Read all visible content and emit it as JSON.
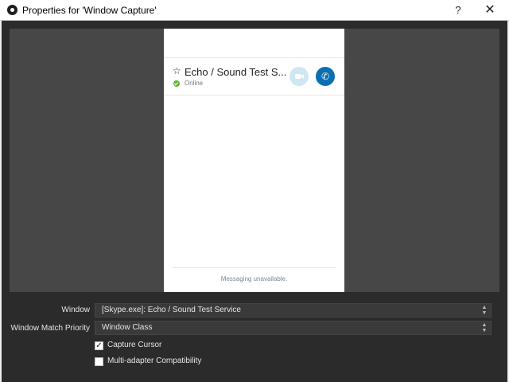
{
  "window": {
    "title": "Properties for 'Window Capture'",
    "help_label": "?",
    "close_label": "✕"
  },
  "capture": {
    "contact_name": "Echo / Sound Test S...",
    "contact_status": "Online",
    "footer_text": "Messaging unavailable."
  },
  "form": {
    "window_label": "Window",
    "window_value": "[Skype.exe]: Echo / Sound Test Service",
    "priority_label": "Window Match Priority",
    "priority_value": "Window Class",
    "capture_cursor_label": "Capture Cursor",
    "capture_cursor_checked": true,
    "multi_adapter_label": "Multi-adapter Compatibility",
    "multi_adapter_checked": false
  },
  "colors": {
    "dialog_bg": "#2b2b2b",
    "preview_bg": "#474747",
    "call_button": "#0a6fb0",
    "status_online": "#5cb82e"
  },
  "icons": {
    "app": "obs-icon",
    "star": "star-icon",
    "video": "video-camera-icon",
    "call": "phone-icon",
    "status": "online-check-icon"
  }
}
